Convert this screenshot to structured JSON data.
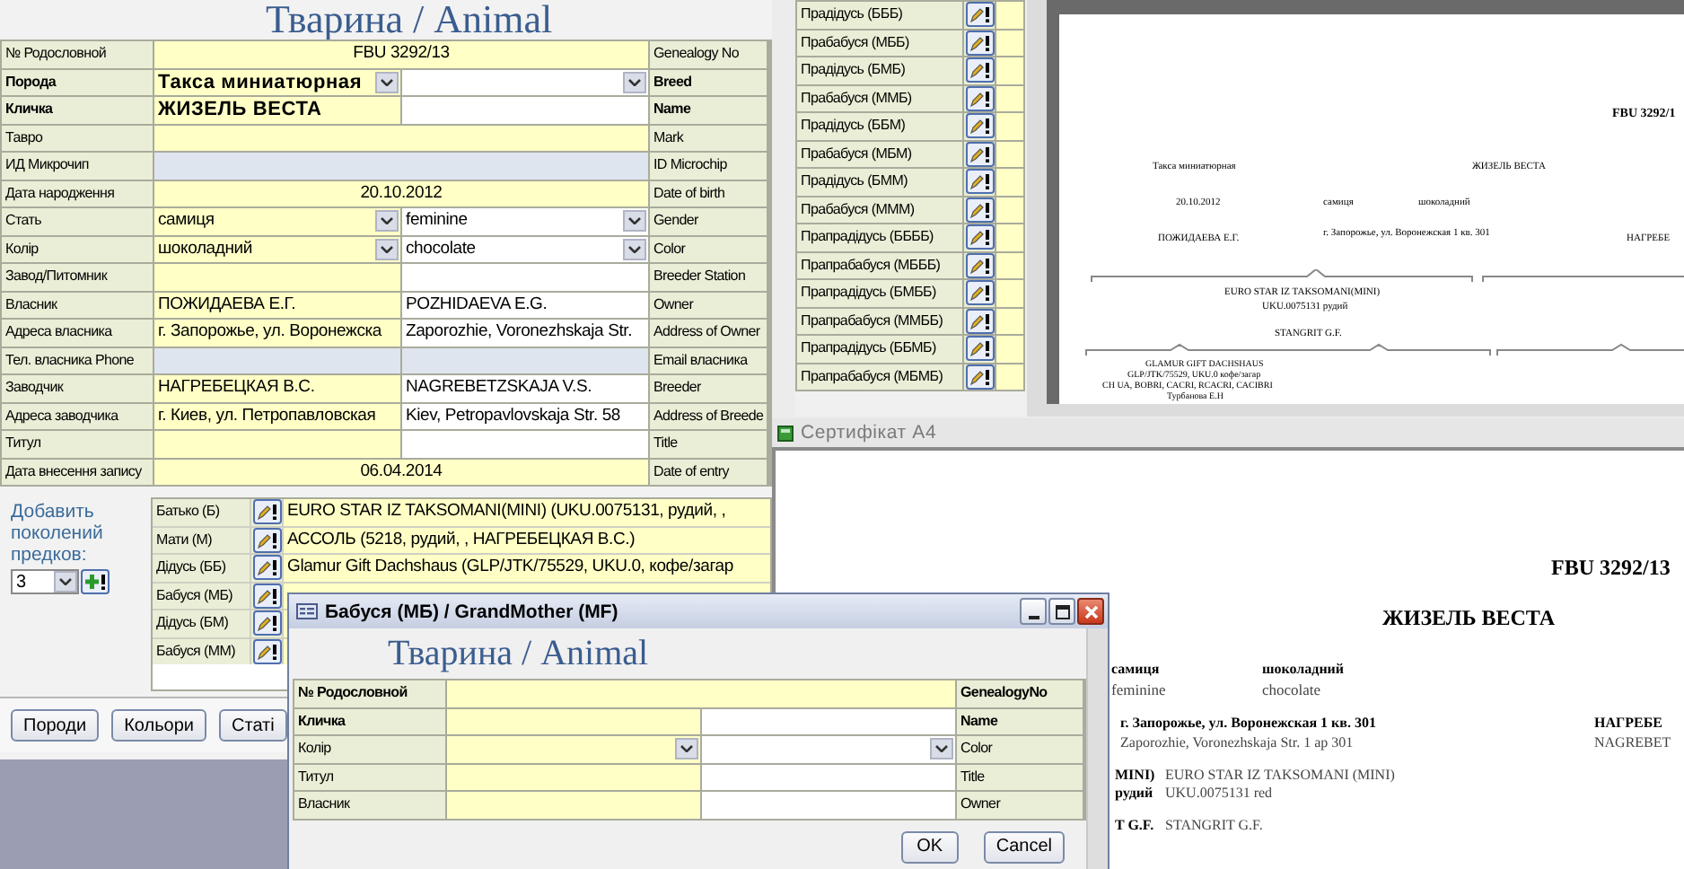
{
  "animal_form": {
    "title": "Тварина / Animal",
    "rows": [
      {
        "kind": "wide",
        "label": "№ Родословной",
        "label_en": "Genealogy No",
        "value": "FBU 3292/13",
        "required": false,
        "shaded": false
      },
      {
        "kind": "select_pair",
        "label": "Порода",
        "label_en": "Breed",
        "value": "Такса миниатюрная",
        "required": true,
        "shaded": false
      },
      {
        "kind": "pair",
        "label": "Кличка",
        "label_en": "Name",
        "value": "ЖИЗЕЛЬ ВЕСТА",
        "required": true,
        "shaded": false
      },
      {
        "kind": "wide",
        "label": "Тавро",
        "label_en": "Mark",
        "required": false,
        "shaded": false
      },
      {
        "kind": "wide",
        "label": "ИД Микрочип",
        "label_en": "ID Microchip",
        "required": false,
        "shaded": true
      },
      {
        "kind": "wide",
        "label": "Дата народження",
        "label_en": "Date of birth",
        "value": "20.10.2012",
        "required": false,
        "shaded": false
      },
      {
        "kind": "select_pair",
        "label": "Стать",
        "label_en": "Gender",
        "value": "самиця",
        "value_en": "feminine",
        "required": false,
        "shaded": false
      },
      {
        "kind": "select_pair",
        "label": "Колір",
        "label_en": "Color",
        "value": "шоколадний",
        "value_en": "chocolate",
        "required": false,
        "shaded": false
      },
      {
        "kind": "pair",
        "label": "Завод/Питомник",
        "label_en": "Breeder Station",
        "required": false,
        "shaded": false
      },
      {
        "kind": "pair",
        "label": "Власник",
        "label_en": "Owner",
        "value": "ПОЖИДАЕВА Е.Г.",
        "value_en": "POZHIDAEVA E.G.",
        "required": false,
        "shaded": false
      },
      {
        "kind": "pair",
        "label": "Адреса власника",
        "label_en": "Address of Owner",
        "value": "г. Запорожье, ул. Воронежска",
        "value_en": "Zaporozhie, Voronezhskaja Str.",
        "required": false,
        "shaded": false
      },
      {
        "kind": "pair",
        "label": "Тел. власника Phone",
        "label_en": "Email власника",
        "required": false,
        "shaded": true
      },
      {
        "kind": "pair",
        "label": "Заводчик",
        "label_en": "Breeder",
        "value": "НАГРЕБЕЦКАЯ В.С.",
        "value_en": "NAGREBETZSKAJA V.S.",
        "required": false,
        "shaded": false
      },
      {
        "kind": "pair",
        "label": "Адреса заводчика",
        "label_en": "Address of Breede",
        "value": "г. Киев, ул. Петропавловская",
        "value_en": "Kiev, Petropavlovskaja Str. 58",
        "required": false,
        "shaded": false
      },
      {
        "kind": "pair",
        "label": "Титул",
        "label_en": "Title",
        "required": false,
        "shaded": false
      },
      {
        "kind": "wide",
        "label": "Дата внесення запису",
        "label_en": "Date of entry",
        "value": "06.04.2014",
        "required": false,
        "shaded": false
      }
    ]
  },
  "pedigree": {
    "add_generations_label": "Добавить поколений предков:",
    "generations": "3",
    "ancestors": [
      {
        "label": "Батько (Б)",
        "value": "EURO STAR IZ TAKSOMANI(MINI) (UKU.0075131, рудий, ,"
      },
      {
        "label": "Мати (М)",
        "value": "АССОЛЬ (5218, рудий, , НАГРЕБЕЦКАЯ В.С.)"
      },
      {
        "label": "Дідусь (ББ)",
        "value": "Glamur Gift Dachshaus (GLP/JTK/75529, UKU.0, кофе/загар"
      },
      {
        "label": "Бабуся (МБ)"
      },
      {
        "label": "Дідусь (БМ)"
      },
      {
        "label": "Бабуся (ММ)"
      }
    ]
  },
  "buttons": [
    "Породи",
    "Кольори",
    "Статі"
  ],
  "ancestor_list": [
    "Прадідусь (БББ)",
    "Прабабуся (МББ)",
    "Прадідусь (БМБ)",
    "Прабабуся (ММБ)",
    "Прадідусь (ББМ)",
    "Прабабуся (МБМ)",
    "Прадідусь (БММ)",
    "Прабабуся (МММ)",
    "Прапрадідусь (ББББ)",
    "Прапрабабуся (МБББ)",
    "Прапрадідусь (БМББ)",
    "Прапрабабуся (ММББ)",
    "Прапрадідусь (ББМБ)",
    "Прапрабабуся (МБМБ)"
  ],
  "preview": {
    "fields": [
      {
        "kind": "number",
        "text": "FBU 3292/1"
      },
      {
        "kind": "breed",
        "text": "Такса миниатюрная"
      },
      {
        "kind": "name",
        "text": "ЖИЗЕЛЬ ВЕСТА"
      },
      {
        "kind": "birth",
        "text": "20.10.2012"
      },
      {
        "kind": "gender",
        "text": "самиця"
      },
      {
        "kind": "color",
        "text": "шоколадний"
      },
      {
        "kind": "owner",
        "text": "ПОЖИДАЕВА Е.Г."
      },
      {
        "kind": "address",
        "text": "г. Запорожье, ул. Воронежская 1 кв. 301"
      },
      {
        "kind": "breeder",
        "text": "НАГРЕБЕ"
      },
      {
        "kind": "sire",
        "text": "EURO STAR IZ TAKSOMANI(MINI)"
      },
      {
        "kind": "sire_info",
        "text": "UKU.0075131 рудий"
      },
      {
        "kind": "sire_owner",
        "text": "STANGRIT G.F."
      },
      {
        "kind": "grandsire",
        "text": "GLAMUR GIFT DACHSHAUS"
      },
      {
        "kind": "grandsire_info",
        "text": "GLP/JTK/75529, UKU.0 кофе/загар"
      },
      {
        "kind": "grandsire_titles",
        "text": "CH UA, BOBRI, CACRI, RCACRI, CACIBRI"
      },
      {
        "kind": "grandsire_owner",
        "text": "Турбанова Е.Н"
      }
    ]
  },
  "certificate": {
    "title": "Сертифікат A4",
    "fields": [
      {
        "kind": "number",
        "text": "FBU 3292/13"
      },
      {
        "kind": "name",
        "text": "ЖИЗЕЛЬ ВЕСТА"
      },
      {
        "kind": "gender",
        "text": "самиця"
      },
      {
        "kind": "gender_en",
        "text": "feminine"
      },
      {
        "kind": "color",
        "text": "шоколадний"
      },
      {
        "kind": "color_en",
        "text": "chocolate"
      },
      {
        "kind": "address",
        "text": "г. Запорожье, ул. Воронежская 1 кв. 301"
      },
      {
        "kind": "address_en",
        "text": "Zaporozhie, Voronezhskaja Str. 1 ap 301"
      },
      {
        "kind": "breeder",
        "text": "НАГРЕБЕ"
      },
      {
        "kind": "breeder_en",
        "text": "NAGREBET"
      }
    ],
    "sire_rows": [
      {
        "label": "MINI)",
        "value": "EURO STAR IZ TAKSOMANI (MINI)"
      },
      {
        "label": "рудий",
        "value": "UKU.0075131 red"
      },
      {
        "label": "T G.F.",
        "value": "STANGRIT G.F."
      }
    ]
  },
  "dialog": {
    "title": "Бабуся (МБ) / GrandMother (MF)",
    "heading": "Тварина / Animal",
    "rows": [
      {
        "kind": "wide",
        "label": "№ Родословной",
        "label_en": "GenealogyNo",
        "required": true,
        "shaded": false
      },
      {
        "kind": "pair",
        "label": "Кличка",
        "label_en": "Name",
        "required": true,
        "shaded": false
      },
      {
        "kind": "select_pair",
        "label": "Колір",
        "label_en": "Color",
        "required": false,
        "shaded": false
      },
      {
        "kind": "pair",
        "label": "Титул",
        "label_en": "Title",
        "required": false,
        "shaded": false
      },
      {
        "kind": "pair",
        "label": "Власник",
        "label_en": "Owner",
        "required": false,
        "shaded": false
      }
    ],
    "buttons": [
      "OK",
      "Cancel"
    ]
  }
}
